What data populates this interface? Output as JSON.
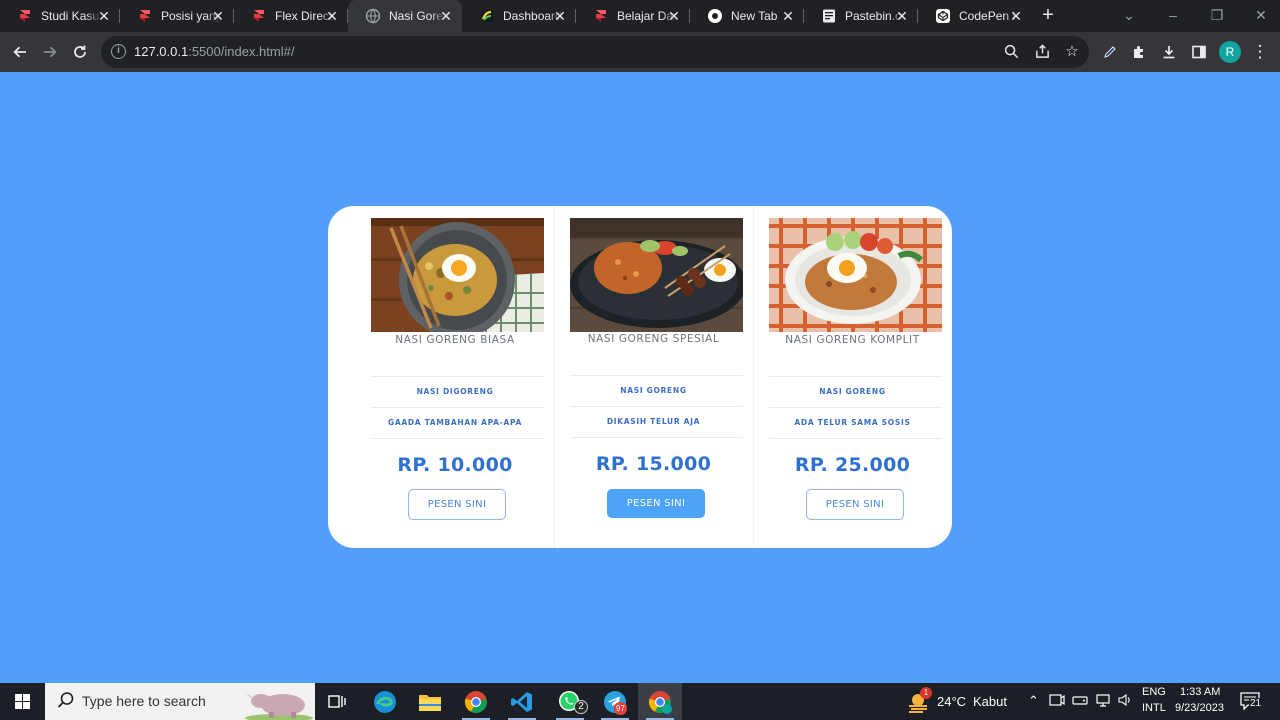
{
  "browser": {
    "tabs": [
      {
        "title": "Studi Kasus",
        "favicon": "framer-red-icon"
      },
      {
        "title": "Posisi yang",
        "favicon": "framer-red-icon"
      },
      {
        "title": "Flex Direction",
        "favicon": "framer-red-icon"
      },
      {
        "title": "Nasi Goreng",
        "favicon": "globe-icon",
        "active": true
      },
      {
        "title": "Dashboard",
        "favicon": "dashboard-icon"
      },
      {
        "title": "Belajar Dasar",
        "favicon": "framer-red-icon"
      },
      {
        "title": "New Tab",
        "favicon": "chrome-icon"
      },
      {
        "title": "Pastebin.com",
        "favicon": "pastebin-icon"
      },
      {
        "title": "CodePen Home",
        "favicon": "codepen-icon"
      }
    ],
    "address": {
      "host": "127.0.0.1",
      "rest": ":5500/index.html#/"
    },
    "profile_initial": "R"
  },
  "menu": {
    "items": [
      {
        "name": "NASI GORENG BIASA",
        "features": [
          "NASI DIGORENG",
          "GAADA TAMBAHAN APA-APA"
        ],
        "price": "RP. 10.000",
        "button": "PESEN SINI",
        "highlighted": false
      },
      {
        "name": "NASI GORENG SPESIAL",
        "features": [
          "NASI GORENG",
          "DIKASIH TELUR AJA"
        ],
        "price": "RP. 15.000",
        "button": "PESEN SINI",
        "highlighted": true
      },
      {
        "name": "NASI GORENG KOMPLIT",
        "features": [
          "NASI GORENG",
          "ADA TELUR SAMA SOSIS"
        ],
        "price": "RP. 25.000",
        "button": "PESEN SINI",
        "highlighted": false
      }
    ]
  },
  "taskbar": {
    "search_placeholder": "Type here to search",
    "apps": [
      "task-view",
      "edge",
      "file-explorer",
      "chrome",
      "vscode",
      "whatsapp",
      "telegram",
      "chrome-profile"
    ],
    "whatsapp_badge": "2",
    "telegram_badge": "97",
    "weather_badge": "1",
    "weather_temp": "24°C",
    "weather_desc": "Kabut",
    "lang_top": "ENG",
    "lang_bottom": "INTL",
    "time": "1:33 AM",
    "date": "9/23/2023",
    "notifications": "21"
  },
  "colors": {
    "page_bg": "#519ffa",
    "price": "#2f71cf",
    "primary_button": "#4da3f7"
  }
}
